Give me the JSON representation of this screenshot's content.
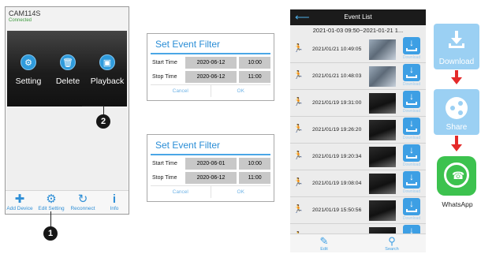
{
  "camera_list": {
    "camera_name": "CAM114S",
    "camera_status": "Connected",
    "actions": [
      {
        "label": "Setting",
        "icon": "gear-icon"
      },
      {
        "label": "Delete",
        "icon": "trash-icon"
      },
      {
        "label": "Playback",
        "icon": "calendar-icon"
      }
    ],
    "toolbar": [
      {
        "label": "Add Device",
        "icon": "plus-icon"
      },
      {
        "label": "Edit Setting",
        "icon": "gear-icon"
      },
      {
        "label": "Reconnect",
        "icon": "refresh-icon"
      },
      {
        "label": "Info",
        "icon": "info-icon"
      }
    ]
  },
  "callouts": {
    "one": "1",
    "two": "2"
  },
  "filter_dialogs": [
    {
      "title": "Set Event Filter",
      "start_label": "Start Time",
      "start_date": "2020-06-12",
      "start_time": "10:00",
      "stop_label": "Stop Time",
      "stop_date": "2020-06-12",
      "stop_time": "11:00",
      "cancel": "Cancel",
      "ok": "OK"
    },
    {
      "title": "Set Event Filter",
      "start_label": "Start Time",
      "start_date": "2020-06-01",
      "start_time": "10:00",
      "stop_label": "Stop Time",
      "stop_date": "2020-06-12",
      "stop_time": "11:00",
      "cancel": "Cancel",
      "ok": "OK"
    }
  ],
  "event_list": {
    "title": "Event List",
    "range": "2021-01-03 09:50~2021-01-21 1...",
    "download_label": "Download",
    "events": [
      {
        "datetime": "2021/01/21  10:49:05",
        "thumb": "light"
      },
      {
        "datetime": "2021/01/21  10:48:03",
        "thumb": "light"
      },
      {
        "datetime": "2021/01/19  19:31:00",
        "thumb": "dark"
      },
      {
        "datetime": "2021/01/19  19:26:20",
        "thumb": "dark"
      },
      {
        "datetime": "2021/01/19  19:20:34",
        "thumb": "dark"
      },
      {
        "datetime": "2021/01/19  19:08:04",
        "thumb": "dark"
      },
      {
        "datetime": "2021/01/19  15:50:56",
        "thumb": "dark"
      },
      {
        "datetime": "2021/01/19  15:38:44",
        "thumb": "dark"
      }
    ],
    "bottom": [
      {
        "label": "Edit",
        "icon": "edit-icon"
      },
      {
        "label": "Search",
        "icon": "search-icon"
      }
    ]
  },
  "share_flow": {
    "download_label": "Download",
    "share_label": "Share",
    "whatsapp_label": "WhatsApp"
  }
}
